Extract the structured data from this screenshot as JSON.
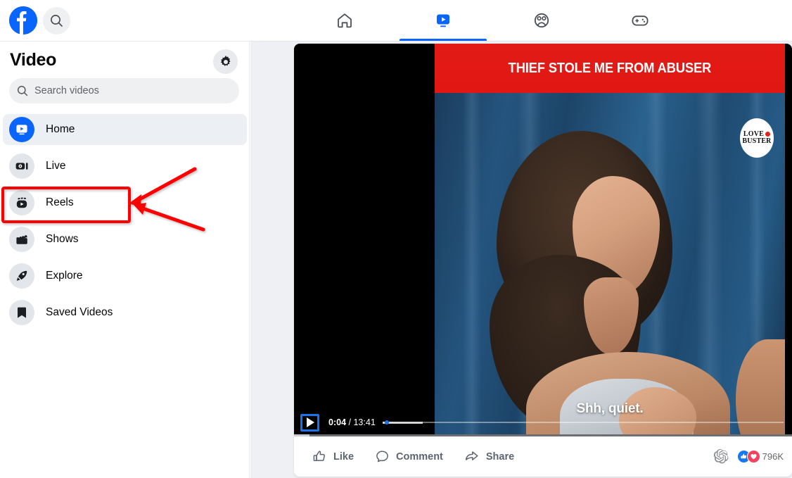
{
  "topbar": {
    "logo_name": "facebook-logo",
    "search_icon": "search-icon",
    "tabs": [
      {
        "name": "home",
        "icon": "home-icon",
        "active": false
      },
      {
        "name": "video",
        "icon": "video-icon",
        "active": true
      },
      {
        "name": "friends",
        "icon": "friends-icon",
        "active": false
      },
      {
        "name": "gaming",
        "icon": "gaming-controller-icon",
        "active": false
      }
    ]
  },
  "sidebar": {
    "title": "Video",
    "settings_icon": "gear-icon",
    "search": {
      "placeholder": "Search videos",
      "value": "",
      "icon": "search-icon"
    },
    "items": [
      {
        "label": "Home",
        "icon": "video-home-icon",
        "selected": true,
        "highlighted": false
      },
      {
        "label": "Live",
        "icon": "live-video-icon",
        "selected": false,
        "highlighted": false
      },
      {
        "label": "Reels",
        "icon": "reels-icon",
        "selected": false,
        "highlighted": true
      },
      {
        "label": "Shows",
        "icon": "clapperboard-icon",
        "selected": false,
        "highlighted": false
      },
      {
        "label": "Explore",
        "icon": "rocket-icon",
        "selected": false,
        "highlighted": false
      },
      {
        "label": "Saved Videos",
        "icon": "bookmark-icon",
        "selected": false,
        "highlighted": false
      }
    ]
  },
  "annotation": {
    "highlight_color": "#ff0000",
    "target_label": "Reels",
    "arrow_count": 2
  },
  "video": {
    "banner_text": "THIEF STOLE ME FROM ABUSER",
    "watermark_line1": "LOVE",
    "watermark_line2": "BUSTER",
    "subtitle": "Shh, quiet.",
    "controls": {
      "play_icon": "play-icon",
      "current_time": "0:04",
      "separator": "/",
      "duration": "13:41",
      "progress_percent": 0.6
    }
  },
  "actions": {
    "like": {
      "label": "Like",
      "icon": "thumbs-up-icon"
    },
    "comment": {
      "label": "Comment",
      "icon": "comment-bubble-icon"
    },
    "share": {
      "label": "Share",
      "icon": "share-arrow-icon"
    },
    "openai_icon": "openai-logo-icon",
    "reactions": {
      "like_icon": "thumbs-up-reaction-icon",
      "love_icon": "heart-reaction-icon",
      "count": "796K"
    }
  },
  "colors": {
    "brand_blue": "#0866ff",
    "banner_red": "#e01713",
    "annotation_red": "#ff0000",
    "page_bg": "#eef0f3"
  }
}
